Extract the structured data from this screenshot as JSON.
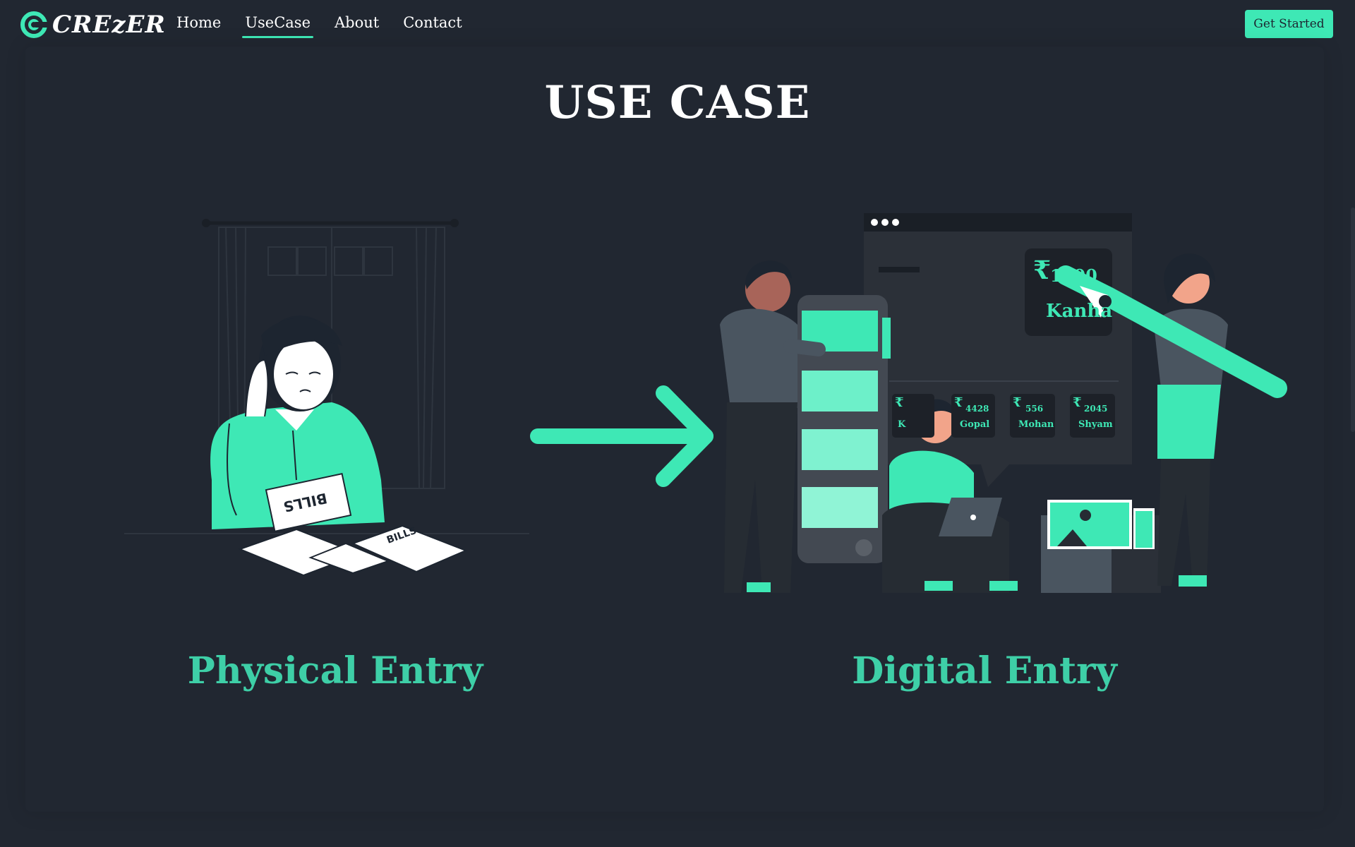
{
  "brand": {
    "name": "CREzER",
    "accent": "#3ee8b5"
  },
  "nav": {
    "items": [
      {
        "label": "Home",
        "active": false
      },
      {
        "label": "UseCase",
        "active": true
      },
      {
        "label": "About",
        "active": false
      },
      {
        "label": "Contact",
        "active": false
      }
    ],
    "cta_label": "Get Started"
  },
  "page": {
    "title": "USE CASE",
    "left_caption": "Physical Entry",
    "right_caption": "Digital Entry"
  },
  "physical_illustration": {
    "bill_label_1": "BILLS",
    "bill_label_2": "BILLS"
  },
  "digital_illustration": {
    "featured": {
      "amount": "1000",
      "name": "Kanha",
      "currency": "₹"
    },
    "cards": [
      {
        "amount": "",
        "name": "K"
      },
      {
        "amount": "4428",
        "name": "Gopal"
      },
      {
        "amount": "556",
        "name": "Mohan"
      },
      {
        "amount": "2045",
        "name": "Shyam"
      }
    ]
  }
}
